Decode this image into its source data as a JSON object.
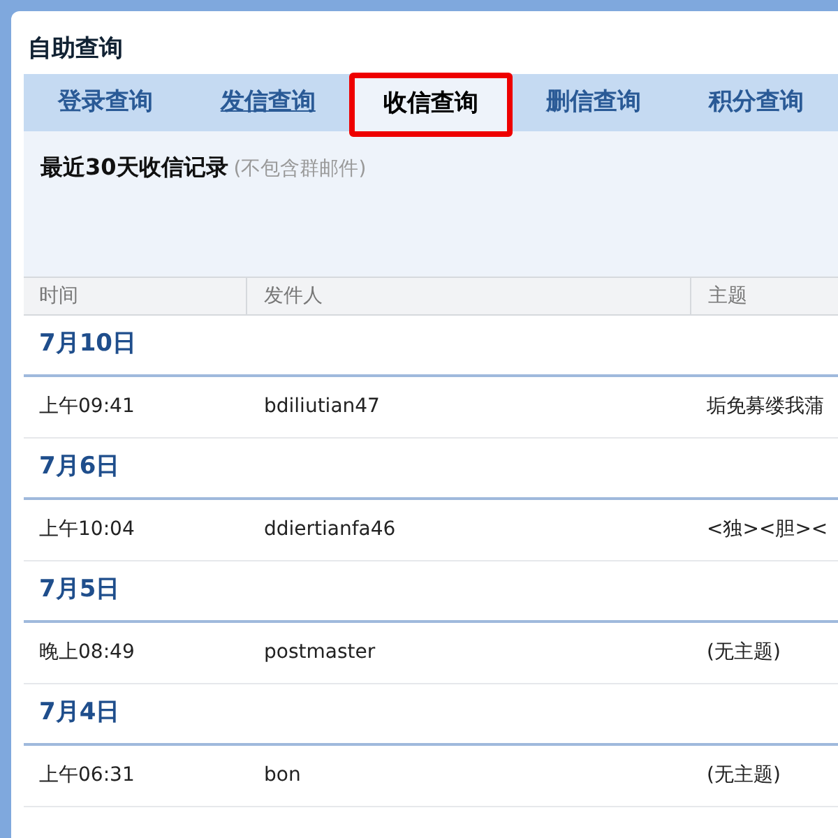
{
  "panel": {
    "title": "自助查询"
  },
  "tabs": [
    {
      "label": "登录查询",
      "selected": false,
      "underlined": false
    },
    {
      "label": "发信查询",
      "selected": false,
      "underlined": true
    },
    {
      "label": "收信查询",
      "selected": true,
      "underlined": false
    },
    {
      "label": "删信查询",
      "selected": false,
      "underlined": false
    },
    {
      "label": "积分查询",
      "selected": false,
      "underlined": false
    }
  ],
  "section": {
    "heading": "最近30天收信记录",
    "note": "(不包含群邮件)"
  },
  "table": {
    "columns": [
      "时间",
      "发件人",
      "主题"
    ],
    "groups": [
      {
        "date": "7月10日",
        "rows": [
          {
            "time": "上午09:41",
            "sender": "bdiliutian47",
            "subject": "垢免募缕我蒲"
          }
        ]
      },
      {
        "date": "7月6日",
        "rows": [
          {
            "time": "上午10:04",
            "sender": "ddiertianfa46",
            "subject": "<独><胆><"
          }
        ]
      },
      {
        "date": "7月5日",
        "rows": [
          {
            "time": "晚上08:49",
            "sender": "postmaster",
            "subject": "(无主题)"
          }
        ]
      },
      {
        "date": "7月4日",
        "rows": [
          {
            "time": "上午06:31",
            "sender": "bon",
            "subject": "(无主题)"
          }
        ]
      }
    ]
  }
}
